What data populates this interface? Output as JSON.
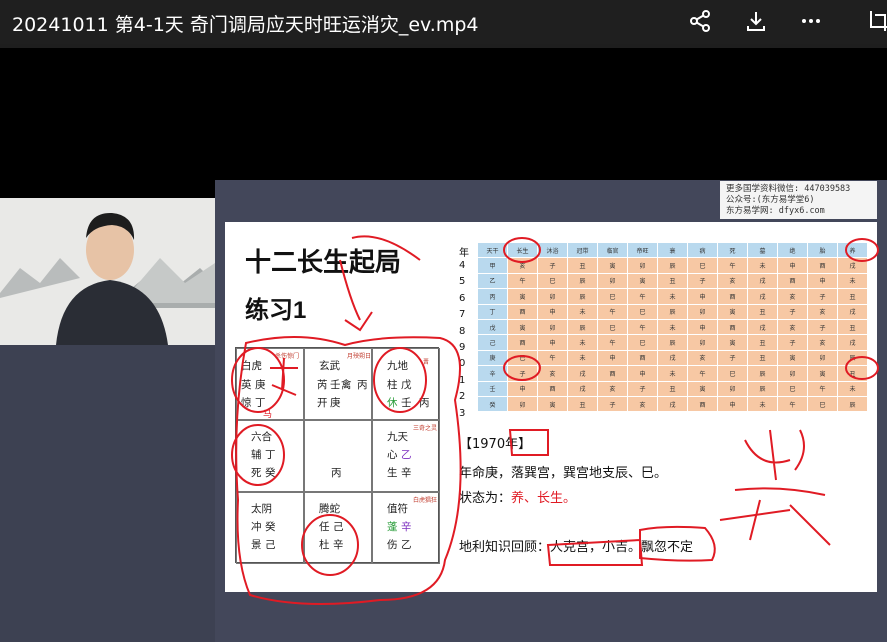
{
  "window": {
    "title": "20241011 第4-1天 奇门调局应天时旺运消灾_ev.mp4",
    "actions": [
      "share-icon",
      "download-icon",
      "more-icon",
      "crop-icon"
    ]
  },
  "watermark": {
    "line1": "更多国学资料微信: 447039583",
    "line2": "公众号:(东方易学堂6)",
    "line3": "东方易学网: dfyx6.com"
  },
  "slide": {
    "heading1": "十二长生起局",
    "heading2": "练习1",
    "palaces": [
      {
        "top": "白虎",
        "top_note": "杀伤惊门",
        "left": "英",
        "mid": "庚",
        "bottom": "惊",
        "bottom2": "丁",
        "extra": "马"
      },
      {
        "top": "玄武",
        "top_note": "月殃朔日",
        "left": "芮",
        "mid": "壬",
        "mid2": "禽",
        "right": "丙",
        "bottom": "开",
        "bottom2": "庚"
      },
      {
        "top": "九地",
        "top_note": "晋",
        "left": "柱",
        "mid": "戊",
        "bottom": "休",
        "bottom2": "壬",
        "right": "丙"
      },
      {
        "top": "六合",
        "top_note": "",
        "left": "辅",
        "mid": "丁",
        "bottom": "死",
        "bottom2": "癸"
      },
      {
        "center": "丙"
      },
      {
        "top": "九天",
        "top_note": "三奇之灵",
        "left": "心",
        "mid": "乙",
        "bottom": "生",
        "bottom2": "辛"
      },
      {
        "top": "太阴",
        "left": "冲",
        "mid": "癸",
        "bottom": "景",
        "bottom2": "己"
      },
      {
        "top": "腾蛇",
        "left": "任",
        "mid": "己",
        "bottom": "杜",
        "bottom2": "辛"
      },
      {
        "top": "值符",
        "top_note": "白虎猖狂",
        "left": "蓬",
        "mid": "辛",
        "bottom": "伤",
        "bottom2": "乙"
      }
    ],
    "year_label": "年",
    "year_digits": [
      "4",
      "5",
      "6",
      "7",
      "8",
      "9",
      "0",
      "1",
      "2",
      "3"
    ],
    "table_header": [
      "天干",
      "长生",
      "沐浴",
      "冠带",
      "临官",
      "帝旺",
      "衰",
      "病",
      "死",
      "墓",
      "绝",
      "胎",
      "养"
    ],
    "table_rows": [
      [
        "甲",
        "亥",
        "子",
        "丑",
        "寅",
        "卯",
        "辰",
        "巳",
        "午",
        "未",
        "申",
        "酉",
        "戌"
      ],
      [
        "乙",
        "午",
        "巳",
        "辰",
        "卯",
        "寅",
        "丑",
        "子",
        "亥",
        "戌",
        "酉",
        "申",
        "未"
      ],
      [
        "丙",
        "寅",
        "卯",
        "辰",
        "巳",
        "午",
        "未",
        "申",
        "酉",
        "戌",
        "亥",
        "子",
        "丑"
      ],
      [
        "丁",
        "酉",
        "申",
        "未",
        "午",
        "巳",
        "辰",
        "卯",
        "寅",
        "丑",
        "子",
        "亥",
        "戌"
      ],
      [
        "戊",
        "寅",
        "卯",
        "辰",
        "巳",
        "午",
        "未",
        "申",
        "酉",
        "戌",
        "亥",
        "子",
        "丑"
      ],
      [
        "己",
        "酉",
        "申",
        "未",
        "午",
        "巳",
        "辰",
        "卯",
        "寅",
        "丑",
        "子",
        "亥",
        "戌"
      ],
      [
        "庚",
        "巳",
        "午",
        "未",
        "申",
        "酉",
        "戌",
        "亥",
        "子",
        "丑",
        "寅",
        "卯",
        "辰"
      ],
      [
        "辛",
        "子",
        "亥",
        "戌",
        "酉",
        "申",
        "未",
        "午",
        "巳",
        "辰",
        "卯",
        "寅",
        "丑"
      ],
      [
        "壬",
        "申",
        "酉",
        "戌",
        "亥",
        "子",
        "丑",
        "寅",
        "卯",
        "辰",
        "巳",
        "午",
        "未"
      ],
      [
        "癸",
        "卯",
        "寅",
        "丑",
        "子",
        "亥",
        "戌",
        "酉",
        "申",
        "未",
        "午",
        "巳",
        "辰"
      ]
    ],
    "year_title": "【1970年】",
    "line1": "年命庚，落巽宫，巽宫地支辰、巳。",
    "line2_prefix": "状态为：",
    "line2_value": "养、长生。",
    "line3_prefix": "地利知识回顾：",
    "line3_value": "人克宫，小吉。飘忽不定"
  },
  "colors": {
    "accent_red": "#e01b24",
    "table_header": "#b9d9ee",
    "table_cell": "#f7c8a4"
  }
}
